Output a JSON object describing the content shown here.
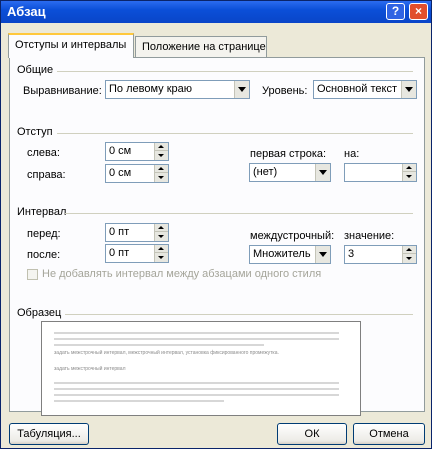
{
  "window": {
    "title": "Абзац",
    "help": "?",
    "close": "×"
  },
  "tabs": [
    {
      "label": "Отступы и интервалы"
    },
    {
      "label": "Положение на странице"
    }
  ],
  "general": {
    "title": "Общие",
    "alignment_label": "Выравнивание:",
    "alignment_value": "По левому краю",
    "level_label": "Уровень:",
    "level_value": "Основной текст"
  },
  "indent": {
    "title": "Отступ",
    "left_label": "слева:",
    "left_value": "0 см",
    "right_label": "справа:",
    "right_value": "0 см",
    "first_line_label": "первая строка:",
    "first_line_value": "(нет)",
    "by_label": "на:",
    "by_value": ""
  },
  "spacing": {
    "title": "Интервал",
    "before_label": "перед:",
    "before_value": "0 пт",
    "after_label": "после:",
    "after_value": "0 пт",
    "line_label": "междустрочный:",
    "line_value": "Множитель",
    "at_label": "значение:",
    "at_value": "3",
    "dont_add_label": "Не добавлять интервал между абзацами одного стиля"
  },
  "preview": {
    "title": "Образец",
    "text_line_1": "задать межстрочный интервал, межстрочный интервал, установка фиксированного промежутка.",
    "text_line_2": "задать межстрочный интервал"
  },
  "buttons": {
    "tabs": "Табуляция...",
    "ok": "ОК",
    "cancel": "Отмена"
  },
  "colors": {
    "title_bar": "#0b4fd8",
    "dialog_bg": "#ece9d8",
    "tab_highlight": "#ffc83c",
    "close_button": "#e14e2c"
  }
}
